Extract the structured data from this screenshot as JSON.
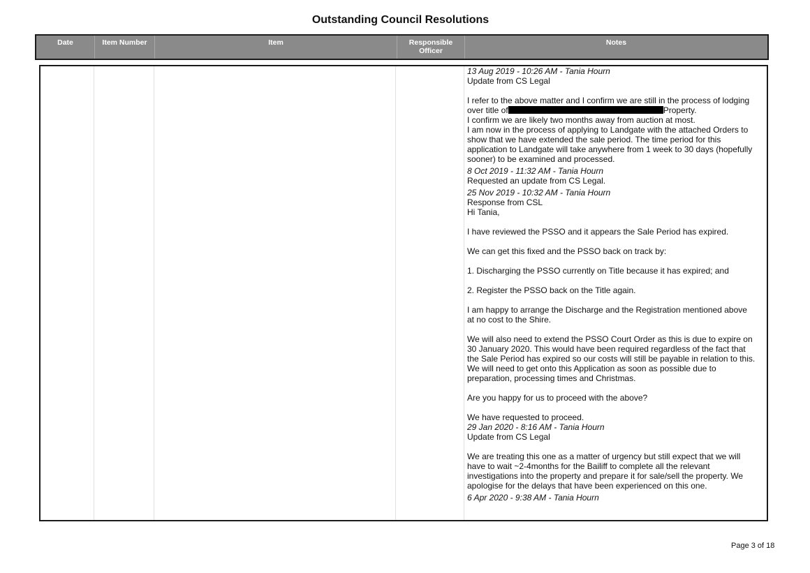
{
  "title": "Outstanding Council Resolutions",
  "columns": {
    "date": "Date",
    "item_number": "Item Number",
    "item": "Item",
    "responsible_officer_line1": "Responsible",
    "responsible_officer_line2": "Officer",
    "notes": "Notes"
  },
  "notes": {
    "e1_stamp": "13 Aug 2019 - 10:26 AM - Tania Hourn",
    "e1_heading": "Update from CS Legal",
    "e1_p1_a": "I refer to the above matter and I confirm we are still in the process of lodging",
    "e1_p1_b_pre": "over title of",
    "e1_p1_b_post": "Property.",
    "e1_p1_c": "I confirm we are likely two months away from auction at most.",
    "e1_p1_d": "I am now in the process of applying to Landgate with the attached Orders to",
    "e1_p1_e": "show that we have extended the sale period. The time period for this",
    "e1_p1_f": "application to Landgate will take anywhere from 1 week to 30 days (hopefully",
    "e1_p1_g": "sooner) to be examined and processed.",
    "e2_stamp": "8 Oct 2019 - 11:32 AM - Tania Hourn",
    "e2_text": "Requested an update from CS Legal.",
    "e3_stamp": "25 Nov 2019 - 10:32 AM - Tania Hourn",
    "e3_heading": "Response from CSL",
    "e3_greeting": "Hi Tania,",
    "e3_p1": "I have reviewed the PSSO and it appears the Sale Period has expired.",
    "e3_p2": "We can get this fixed and the PSSO back on track by:",
    "e3_p3": "1. Discharging the PSSO currently on Title because it has expired; and",
    "e3_p4": "2. Register the PSSO back on the Title again.",
    "e3_p5_a": "I am happy to arrange the Discharge and the Registration mentioned above",
    "e3_p5_b": "at no cost to the Shire.",
    "e3_p6_a": "We will also need to extend the PSSO Court Order as this is due to expire on",
    "e3_p6_b": "30 January 2020. This would have been required regardless of the fact that",
    "e3_p6_c": "the Sale Period has expired so our costs will still be payable in relation to this.",
    "e3_p6_d": "We will need to get onto this Application as soon as possible due to",
    "e3_p6_e": "preparation, processing times and Christmas.",
    "e3_p7": "Are you happy for us to proceed with the above?",
    "e3_p8": "We have requested to proceed.",
    "e4_stamp": "29 Jan 2020 - 8:16 AM - Tania Hourn",
    "e4_heading": "Update from CS Legal",
    "e4_p1_a": "We are treating this one as a matter of urgency but still expect that we will",
    "e4_p1_b": "have to wait ~2-4months for the Bailiff to complete all the relevant",
    "e4_p1_c": "investigations into the property and prepare it for sale/sell the property. We",
    "e4_p1_d": "apologise for the delays that have been experienced on this one.",
    "e5_stamp": "6 Apr 2020 - 9:38 AM - Tania Hourn"
  },
  "footer": "Page 3 of 18"
}
